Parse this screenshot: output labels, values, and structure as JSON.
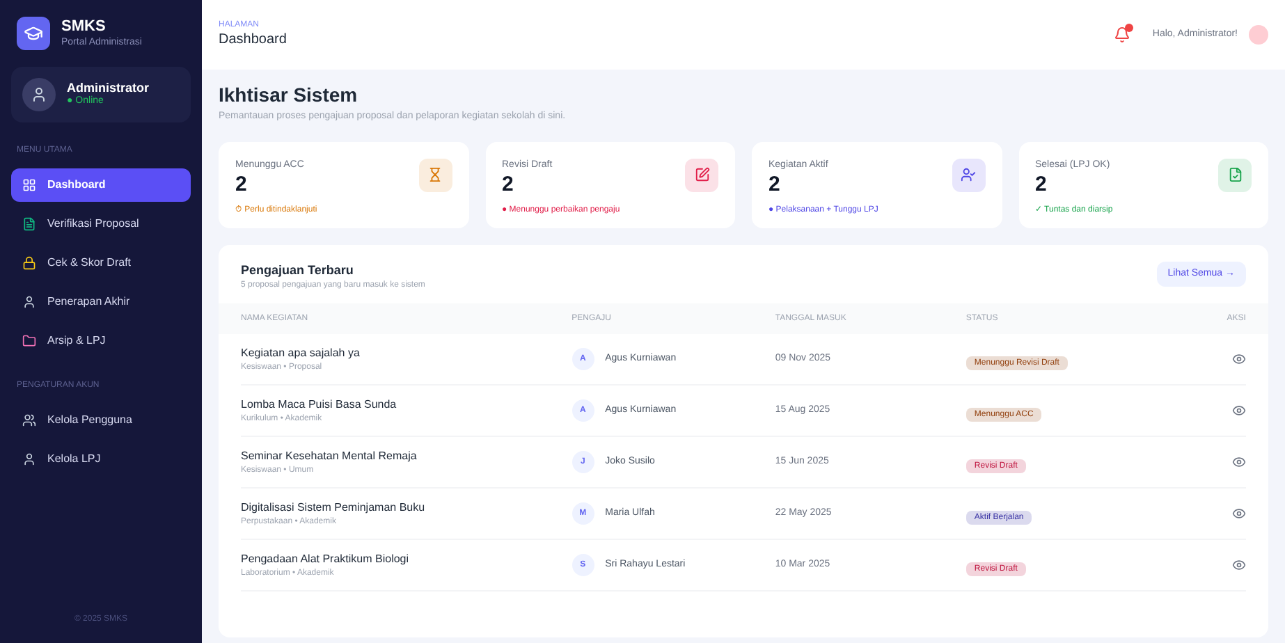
{
  "sidebar": {
    "brand": {
      "name": "SMKS",
      "tagline": "Portal Administrasi"
    },
    "user": {
      "name": "Administrator",
      "status": "● Online"
    },
    "sections": [
      {
        "title": "MENU UTAMA",
        "items": [
          {
            "label": "Dashboard",
            "selected": true,
            "color": "#ffffff"
          },
          {
            "label": "Verifikasi Proposal",
            "selected": false,
            "color": "#10b981"
          },
          {
            "label": "Cek & Skor Draft",
            "selected": false,
            "color": "#facc15"
          },
          {
            "label": "Penerapan Akhir",
            "selected": false,
            "color": "#cbd5e1"
          },
          {
            "label": "Arsip & LPJ",
            "selected": false,
            "color": "#f472b6"
          }
        ]
      },
      {
        "title": "PENGATURAN AKUN",
        "items": [
          {
            "label": "Kelola Pengguna",
            "selected": false,
            "color": "#cbd5e1"
          },
          {
            "label": "Kelola LPJ",
            "selected": false,
            "color": "#cbd5e1"
          }
        ]
      }
    ],
    "footer": "© 2025 SMKS"
  },
  "header": {
    "breadcrumb": "HALAMAN",
    "title": "Dashboard",
    "greeting": "Halo, Administrator!"
  },
  "overview": {
    "title": "Ikhtisar Sistem",
    "subtitle": "Pemantauan proses pengajuan proposal dan pelaporan kegiatan sekolah di sini."
  },
  "stats": [
    {
      "label": "Menunggu ACC",
      "value": "2",
      "note": "⏱ Perlu ditindaklanjuti",
      "color": "#d97706"
    },
    {
      "label": "Revisi Draft",
      "value": "2",
      "note": "● Menunggu perbaikan pengaju",
      "color": "#e11d48"
    },
    {
      "label": "Kegiatan Aktif",
      "value": "2",
      "note": "● Pelaksanaan + Tunggu LPJ",
      "color": "#4f46e5"
    },
    {
      "label": "Selesai (LPJ OK)",
      "value": "2",
      "note": "✓ Tuntas dan diarsip",
      "color": "#16a34a"
    }
  ],
  "recent": {
    "title": "Pengajuan Terbaru",
    "subtitle": "5 proposal pengajuan yang baru masuk ke sistem",
    "view_all": "Lihat Semua →",
    "columns": [
      "NAMA KEGIATAN",
      "PENGAJU",
      "TANGGAL MASUK",
      "STATUS",
      "AKSI"
    ],
    "rows": [
      {
        "name": "Kegiatan apa sajalah ya",
        "unit": "Kesiswaan • Proposal",
        "initial": "A",
        "applicant": "Agus Kurniawan",
        "date": "09 Nov 2025",
        "status": "Menunggu Revisi Draft",
        "color": "#92400e"
      },
      {
        "name": "Lomba Maca Puisi Basa Sunda",
        "unit": "Kurikulum • Akademik",
        "initial": "A",
        "applicant": "Agus Kurniawan",
        "date": "15 Aug 2025",
        "status": "Menunggu ACC",
        "color": "#92400e"
      },
      {
        "name": "Seminar Kesehatan Mental Remaja",
        "unit": "Kesiswaan • Umum",
        "initial": "J",
        "applicant": "Joko Susilo",
        "date": "15 Jun 2025",
        "status": "Revisi Draft",
        "color": "#be123c"
      },
      {
        "name": "Digitalisasi Sistem Peminjaman Buku",
        "unit": "Perpustakaan • Akademik",
        "initial": "M",
        "applicant": "Maria Ulfah",
        "date": "22 May 2025",
        "status": "Aktif Berjalan",
        "color": "#3730a3"
      },
      {
        "name": "Pengadaan Alat Praktikum Biologi",
        "unit": "Laboratorium • Akademik",
        "initial": "S",
        "applicant": "Sri Rahayu Lestari",
        "date": "10 Mar 2025",
        "status": "Revisi Draft",
        "color": "#be123c"
      }
    ]
  }
}
